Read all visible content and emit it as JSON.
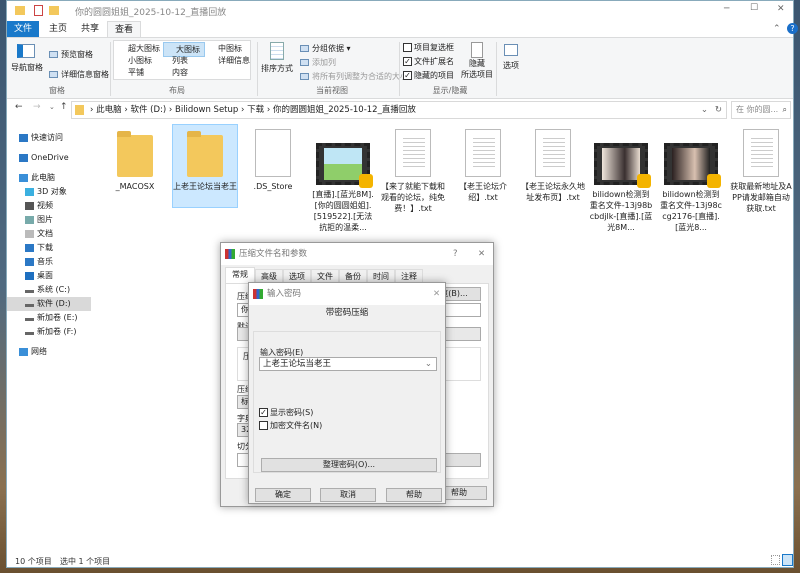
{
  "window": {
    "title": "你的圆圆姐姐_2025-10-12_直播回放",
    "minimize": "─",
    "maximize": "☐",
    "close": "✕"
  },
  "ribbon_tabs": [
    {
      "label": "文件",
      "active": false,
      "accent": "#1979ca"
    },
    {
      "label": "主页"
    },
    {
      "label": "共享"
    },
    {
      "label": "查看",
      "active": true
    }
  ],
  "ribbon": {
    "pane": {
      "nav_pane": "导航窗格",
      "preview": "预览窗格",
      "details": "详细信息窗格",
      "group": "窗格"
    },
    "layout": {
      "items": [
        "超大图标",
        "大图标",
        "中图标",
        "小图标",
        "列表",
        "详细信息",
        "平铺",
        "内容"
      ],
      "selected": "大图标",
      "group": "布局"
    },
    "view": {
      "sort": "排序方式",
      "group_by": "分组依据",
      "add_col": "添加列",
      "fit_cols": "将所有列调整为合适的大小",
      "group": "当前视图"
    },
    "show": {
      "item_check": "项目复选框",
      "ext": "文件扩展名",
      "hidden": "隐藏的项目",
      "item_check_on": false,
      "ext_on": true,
      "hidden_on": true,
      "hide_sel_1": "隐藏",
      "hide_sel_2": "所选项目",
      "group": "显示/隐藏"
    },
    "options": "选项"
  },
  "address": {
    "crumbs": [
      "此电脑",
      "软件 (D:)",
      "Bilidown Setup",
      "下载",
      "你的圆圆姐姐_2025-10-12_直播回放"
    ],
    "search_placeholder": "在 你的圆..."
  },
  "nav": [
    {
      "label": "快速访问",
      "icon": "star-icon"
    },
    {
      "label": "OneDrive",
      "icon": "cloud-icon"
    },
    {
      "label": "此电脑",
      "icon": "computer-icon"
    },
    {
      "label": "3D 对象",
      "icon": "cube-icon"
    },
    {
      "label": "视频",
      "icon": "video-icon"
    },
    {
      "label": "图片",
      "icon": "picture-icon"
    },
    {
      "label": "文档",
      "icon": "document-icon"
    },
    {
      "label": "下载",
      "icon": "download-icon"
    },
    {
      "label": "音乐",
      "icon": "music-icon"
    },
    {
      "label": "桌面",
      "icon": "desktop-icon"
    },
    {
      "label": "系统 (C:)",
      "icon": "drive-icon"
    },
    {
      "label": "软件 (D:)",
      "icon": "drive-icon",
      "selected": true
    },
    {
      "label": "新加卷 (E:)",
      "icon": "drive-icon"
    },
    {
      "label": "新加卷 (F:)",
      "icon": "drive-icon"
    },
    {
      "label": "网络",
      "icon": "network-icon"
    }
  ],
  "files": [
    {
      "name": "_MACOSX",
      "type": "folder"
    },
    {
      "name": "上老王论坛当老王",
      "type": "folder",
      "selected": true
    },
    {
      "name": ".DS_Store",
      "type": "file"
    },
    {
      "name": "[直播].[蓝光8M].[你的圆圆姐姐].[519522].[无法抗拒的温柔...",
      "type": "video"
    },
    {
      "name": "【来了就能下载和观看的论坛，纯免费！】.txt",
      "type": "txt"
    },
    {
      "name": "【老王论坛介绍】.txt",
      "type": "txt"
    },
    {
      "name": "【老王论坛永久地址发布页】.txt",
      "type": "txt"
    },
    {
      "name": "bilidown检测到重名文件-13j98bcbdjlk-[直播].[蓝光8M...",
      "type": "video"
    },
    {
      "name": "bilidown检测到重名文件-13j98ccg2176-[直播].[蓝光8...",
      "type": "video"
    },
    {
      "name": "获取最新地址及APP请发邮箱自动获取.txt",
      "type": "txt"
    }
  ],
  "status": {
    "count": "10 个项目",
    "selected": "选中 1 个项目"
  },
  "archive_dialog": {
    "title": "压缩文件名和参数",
    "help_q": "?",
    "close": "✕",
    "tabs": [
      "常规",
      "高级",
      "选项",
      "文件",
      "备份",
      "时间",
      "注释"
    ],
    "labels": [
      "压缩文件名(A)",
      "你的",
      "默认",
      "压缩",
      "压缩方式",
      "标准",
      "字典大小",
      "32 MB",
      "切分"
    ],
    "browse": "浏览(B)...",
    "help": "帮助"
  },
  "password_dialog": {
    "title": "输入密码",
    "close": "✕",
    "heading": "带密码压缩",
    "field_label": "输入密码(E)",
    "password": "上老王论坛当老王",
    "show_password": "显示密码(S)",
    "show_password_on": true,
    "encrypt_names": "加密文件名(N)",
    "encrypt_names_on": false,
    "organize": "整理密码(O)...",
    "ok": "确定",
    "cancel": "取消",
    "help": "帮助"
  }
}
